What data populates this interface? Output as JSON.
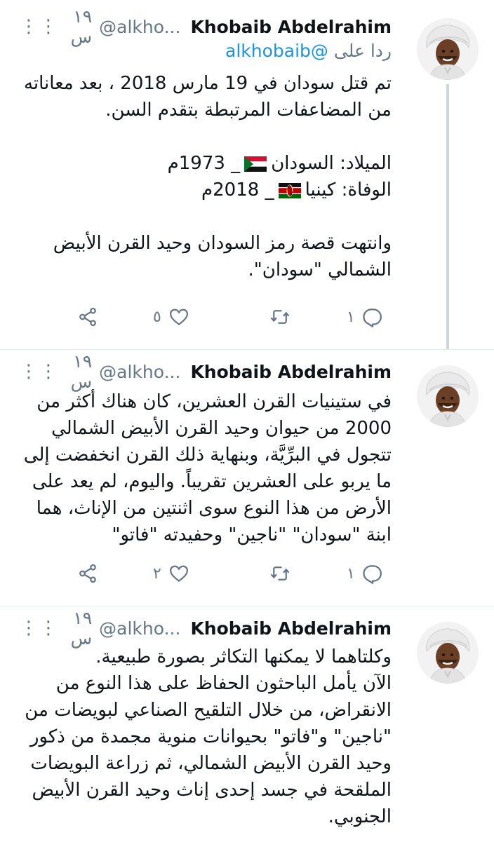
{
  "tweets": [
    {
      "name": "Khobaib Abdelrahim",
      "handle": "@alkho...",
      "time": "١٩ س",
      "reply_prefix": "ردا على",
      "reply_handle": "@alkhobaib",
      "lines": [
        "تم قتل سودان في 19 مارس 2018 ، بعد معاناته",
        "من المضاعفات المرتبطة بتقدم السن.",
        "",
        "الميلاد: السودان",
        "_ 1973م",
        "الوفاة: كينيا",
        "_ 2018م",
        "",
        "وانتهت قصة رمز السودان وحيد القرن الأبيض",
        "الشمالي \"سودان\"."
      ],
      "likes": "٥",
      "replies": "١"
    },
    {
      "name": "Khobaib Abdelrahim",
      "handle": "@alkho...",
      "time": "١٩ س",
      "lines": [
        "في ستينيات القرن العشرين، كان هناك أكثر من",
        "2000 من حيوان وحيد القرن الأبيض الشمالي",
        "تتجول في البرِّيَّة، وبنهاية ذلك القرن انخفضت إلى",
        "ما يربو على العشرين تقريباً. واليوم، لم يعد على",
        "الأرض من هذا النوع سوى اثنتين من الإناث، هما",
        "ابنة \"سودان\" \"ناجين\" وحفيدته \"فاتو\""
      ],
      "likes": "٢",
      "replies": "١"
    },
    {
      "name": "Khobaib Abdelrahim",
      "handle": "@alkho...",
      "time": "١٩ س",
      "lines": [
        "وكلتاهما لا يمكنها التكاثر بصورة طبيعية.",
        "الآن يأمل الباحثون الحفاظ على هذا النوع من",
        "الانقراض، من خلال التلقيح الصناعي لبويضات من",
        "\"ناجين\" و\"فاتو\" بحيوانات منوية مجمدة من ذكور",
        "وحيد القرن الأبيض الشمالي، ثم زراعة البويضات",
        "الملقحة في جسد إحدى إناث وحيد القرن الأبيض",
        "الجنوبي."
      ]
    }
  ],
  "icons": {
    "more": "more-dots-icon",
    "share": "share-icon",
    "like": "heart-icon",
    "retweet": "retweet-icon",
    "reply": "reply-icon"
  },
  "colors": {
    "link": "#1b95e0",
    "muted": "#657786",
    "thread": "#ccd6dd"
  }
}
